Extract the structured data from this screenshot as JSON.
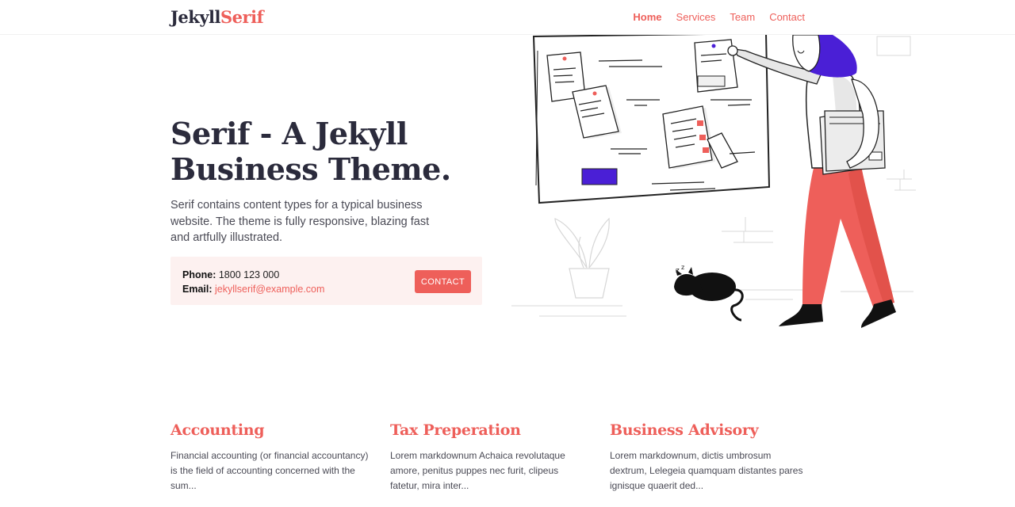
{
  "header": {
    "logo_part1": "Jekyll",
    "logo_part2": "Serif",
    "nav": [
      {
        "label": "Home",
        "active": true
      },
      {
        "label": "Services"
      },
      {
        "label": "Team"
      },
      {
        "label": "Contact"
      }
    ]
  },
  "hero": {
    "title_line1": "Serif - A Jekyll",
    "title_line2": "Business Theme.",
    "description": "Serif contains content types for a typical business website. The theme is fully responsive, blazing fast and artfully illustrated.",
    "phone_label": "Phone:",
    "phone_value": "1800 123 000",
    "email_label": "Email:",
    "email_value": "jekyllserif@example.com",
    "contact_button": "CONTACT"
  },
  "services": [
    {
      "title": "Accounting",
      "summary": "Financial accounting (or financial accountancy) is the field of accounting concerned with the sum..."
    },
    {
      "title": "Tax Preperation",
      "summary": "Lorem markdownum Achaica revolutaque amore, penitus puppes nec furit, clipeus fatetur, mira inter..."
    },
    {
      "title": "Business Advisory",
      "summary": "Lorem markdownum, dictis umbrosum dextrum, Lelegeia quamquam distantes pares ignisque quaerit ded..."
    }
  ],
  "colors": {
    "accent": "#ee5f5a",
    "heading": "#2b2b3c",
    "contact_bg": "#fdf1f0",
    "illustration_purple": "#4a1fd6"
  }
}
